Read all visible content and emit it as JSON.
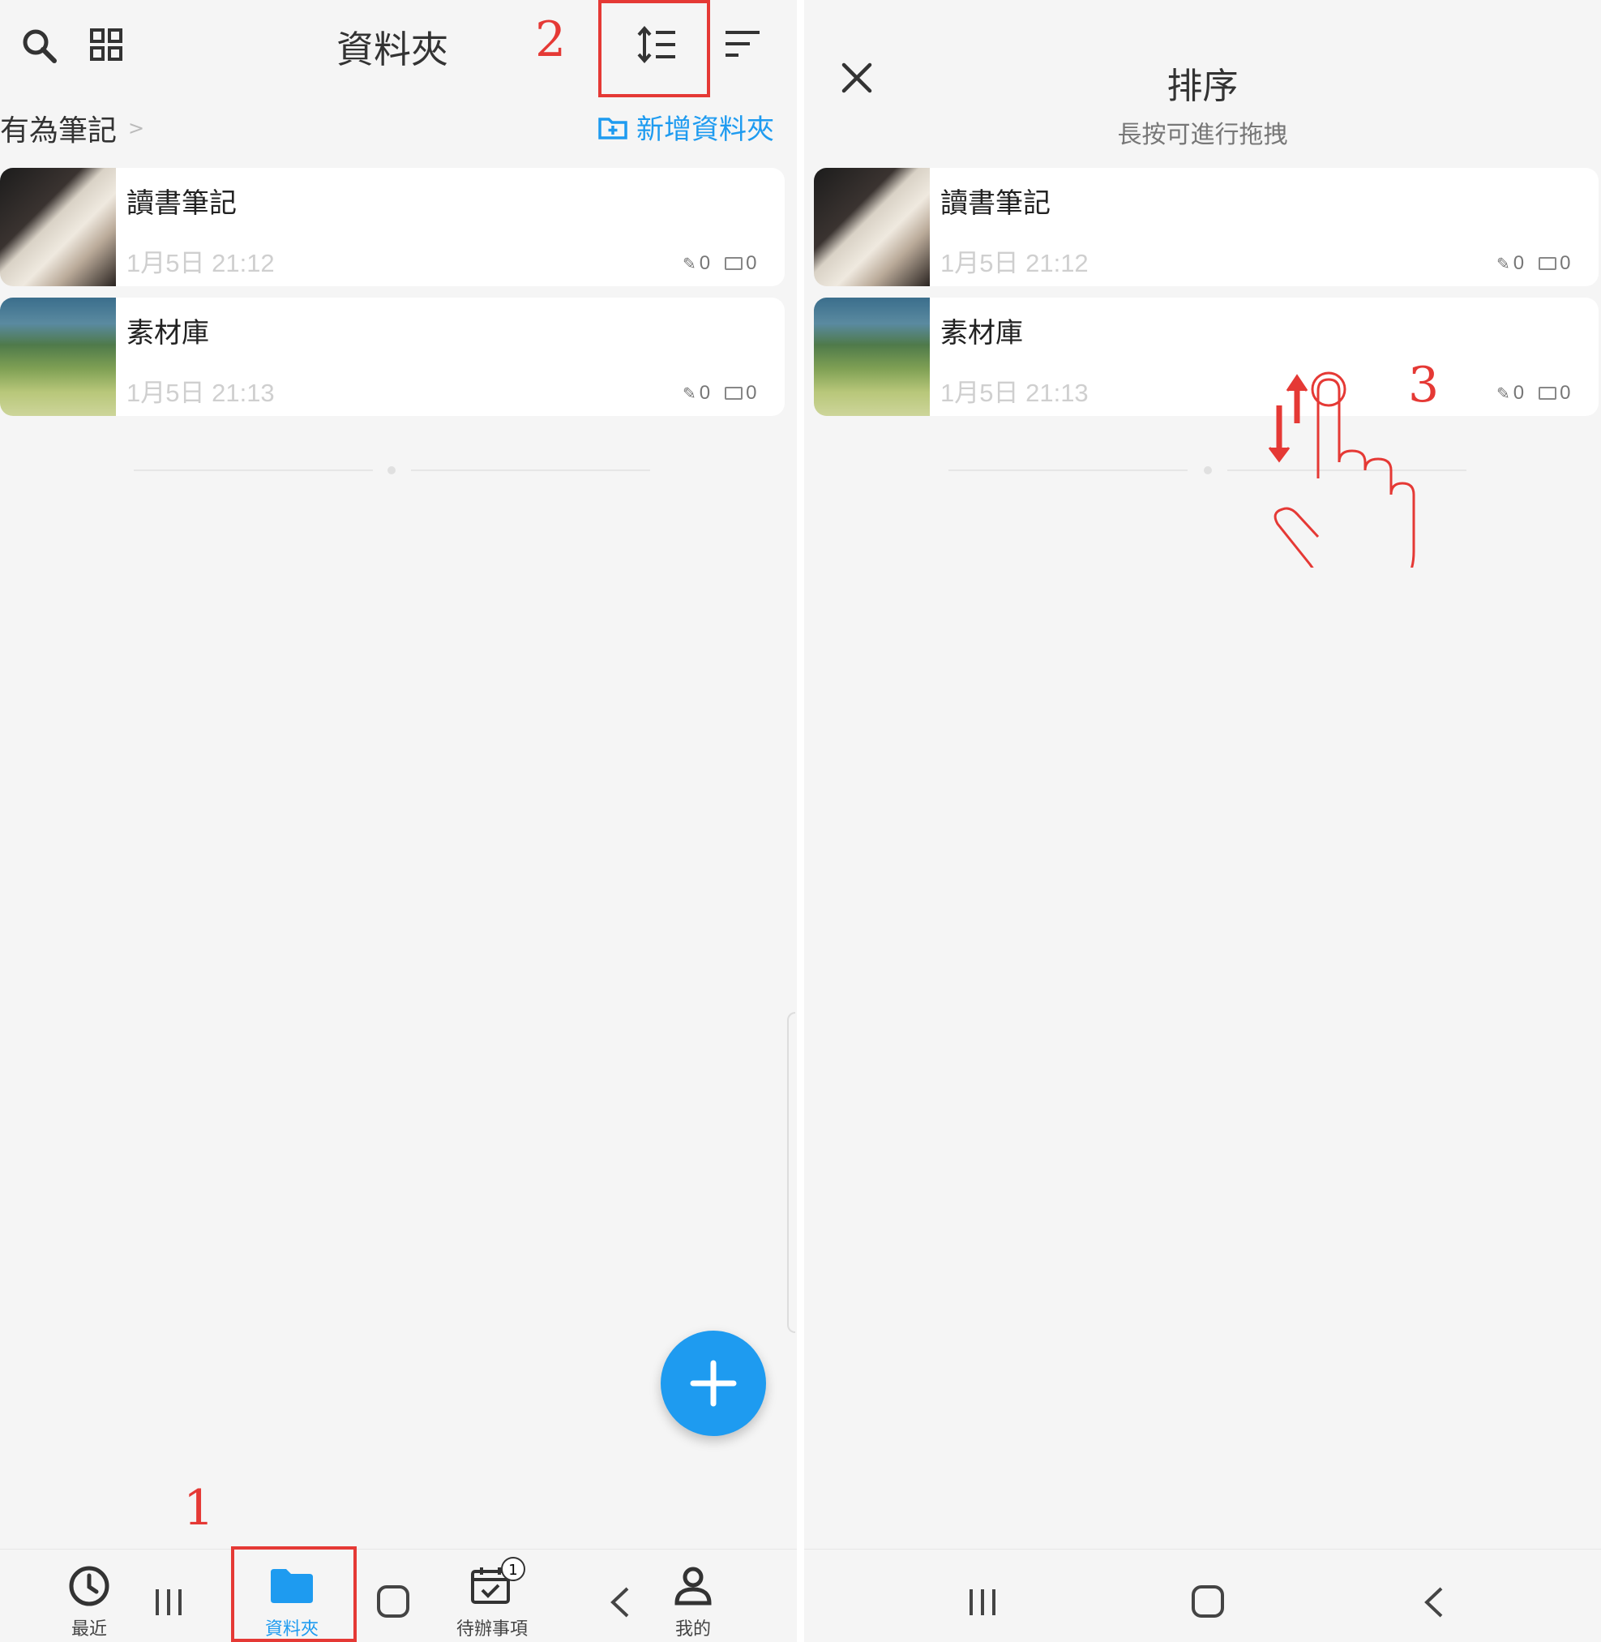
{
  "left": {
    "header": {
      "title": "資料夾",
      "search_icon": "search-icon",
      "grid_icon": "grid-icon",
      "sort_order_icon": "reorder-icon",
      "filter_icon": "sort-icon"
    },
    "breadcrumb": {
      "root": "有為筆記",
      "separator": ">"
    },
    "new_folder_label": "新增資料夾",
    "folders": [
      {
        "name": "讀書筆記",
        "date": "1月5日 21:12",
        "attachments": "0",
        "subfolders": "0"
      },
      {
        "name": "素材庫",
        "date": "1月5日 21:13",
        "attachments": "0",
        "subfolders": "0"
      }
    ],
    "fab_icon": "plus-icon",
    "bottom_nav": [
      {
        "label": "最近",
        "icon": "clock-icon"
      },
      {
        "label": "資料夾",
        "icon": "folder-icon",
        "active": true
      },
      {
        "label": "待辦事項",
        "icon": "calendar-check-icon",
        "badge": "1"
      },
      {
        "label": "我的",
        "icon": "person-icon"
      }
    ]
  },
  "right": {
    "header": {
      "title": "排序",
      "subtitle": "長按可進行拖拽",
      "close_icon": "close-icon"
    },
    "folders": [
      {
        "name": "讀書筆記",
        "date": "1月5日 21:12",
        "attachments": "0",
        "subfolders": "0"
      },
      {
        "name": "素材庫",
        "date": "1月5日 21:13",
        "attachments": "0",
        "subfolders": "0"
      }
    ]
  },
  "annotations": {
    "step1": "1",
    "step2": "2",
    "step3": "3"
  },
  "colors": {
    "accent": "#1e9bf0",
    "annotation": "#e53935",
    "background": "#f5f5f5"
  }
}
